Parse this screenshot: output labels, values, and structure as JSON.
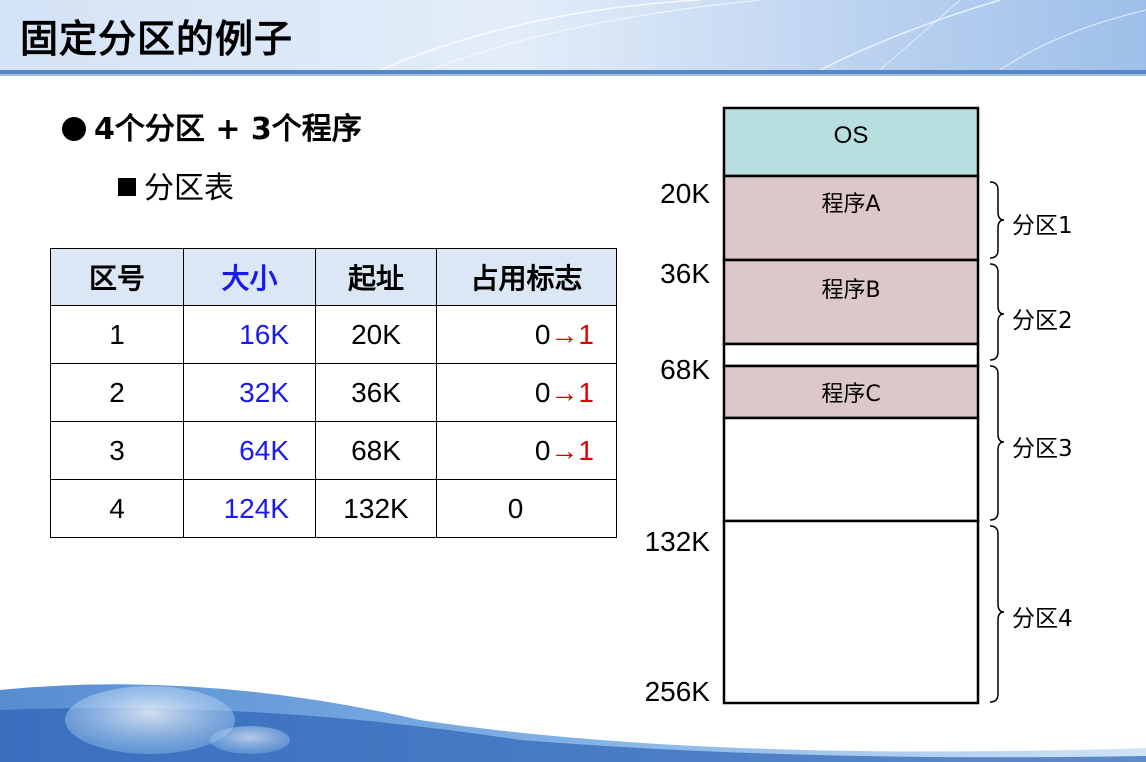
{
  "slide": {
    "title": "固定分区的例子"
  },
  "bullets": {
    "main_prefix": "4",
    "main_mid": "个分区 + ",
    "main_num": "3",
    "main_suffix": "个程序",
    "sub": "分区表"
  },
  "table": {
    "headers": [
      "区号",
      "大小",
      "起址",
      "占用标志"
    ],
    "rows": [
      {
        "no": "1",
        "size": "16K",
        "start": "20K",
        "flag_from": "0",
        "flag_to": "→1"
      },
      {
        "no": "2",
        "size": "32K",
        "start": "36K",
        "flag_from": "0",
        "flag_to": "→1"
      },
      {
        "no": "3",
        "size": "64K",
        "start": "68K",
        "flag_from": "0",
        "flag_to": "→1"
      },
      {
        "no": "4",
        "size": "124K",
        "start": "132K",
        "flag_from": "0",
        "flag_to": ""
      }
    ]
  },
  "memory": {
    "blocks": {
      "os": "OS",
      "prog_a": "程序A",
      "prog_b": "程序B",
      "prog_c": "程序C"
    },
    "addresses": [
      "20K",
      "36K",
      "68K",
      "132K",
      "256K"
    ],
    "partitions": [
      "分区1",
      "分区2",
      "分区3",
      "分区4"
    ]
  },
  "colors": {
    "os_fill": "#b8dfe0",
    "program_fill": "#dcc7c9",
    "size_text": "#1a1af0",
    "flag_arrow": "#e00000",
    "header_fill": "#dbe7f4"
  }
}
